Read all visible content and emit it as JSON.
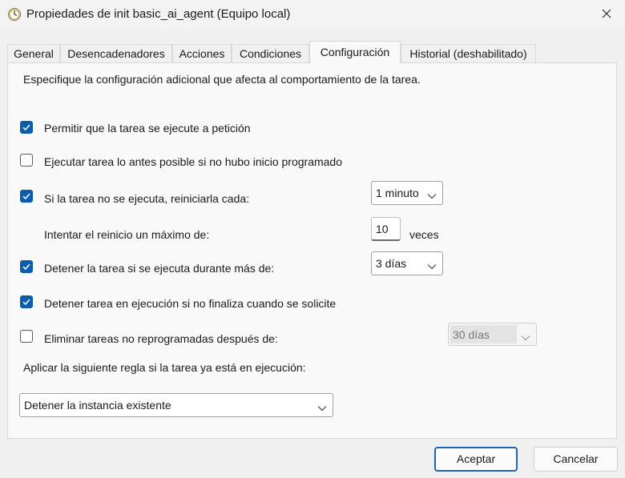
{
  "window": {
    "title": "Propiedades de init basic_ai_agent (Equipo local)",
    "icon": "clock-task-icon"
  },
  "tabs": [
    {
      "label": "General"
    },
    {
      "label": "Desencadenadores"
    },
    {
      "label": "Acciones"
    },
    {
      "label": "Condiciones"
    },
    {
      "label": "Configuración",
      "active": true
    },
    {
      "label": "Historial (deshabilitado)"
    }
  ],
  "settings": {
    "intro": "Especifique la configuración adicional que afecta al comportamiento de la tarea.",
    "allow_on_demand": {
      "label": "Permitir que la tarea se ejecute a petición",
      "checked": true
    },
    "run_asap": {
      "label": "Ejecutar tarea lo antes posible si no hubo inicio programado",
      "checked": false
    },
    "restart_on_fail": {
      "label": "Si la tarea no se ejecuta, reiniciarla cada:",
      "checked": true,
      "interval": "1 minuto"
    },
    "restart_attempts": {
      "label": "Intentar el reinicio un máximo de:",
      "value": "10",
      "unit": "veces"
    },
    "stop_if_runs_longer": {
      "label": "Detener la tarea si se ejecuta durante más de:",
      "checked": true,
      "duration": "3 días"
    },
    "force_stop": {
      "label": "Detener tarea en ejecución si no finaliza cuando se solicite",
      "checked": true
    },
    "delete_expired": {
      "label": "Eliminar tareas no reprogramadas después de:",
      "checked": false,
      "duration": "30 días"
    },
    "rule_label": "Aplicar la siguiente regla si la tarea ya está en ejecución:",
    "rule_value": "Detener la instancia existente"
  },
  "buttons": {
    "accept": "Aceptar",
    "cancel": "Cancelar"
  },
  "colors": {
    "accent": "#0b5cad",
    "primary_border": "#1f63b6"
  }
}
